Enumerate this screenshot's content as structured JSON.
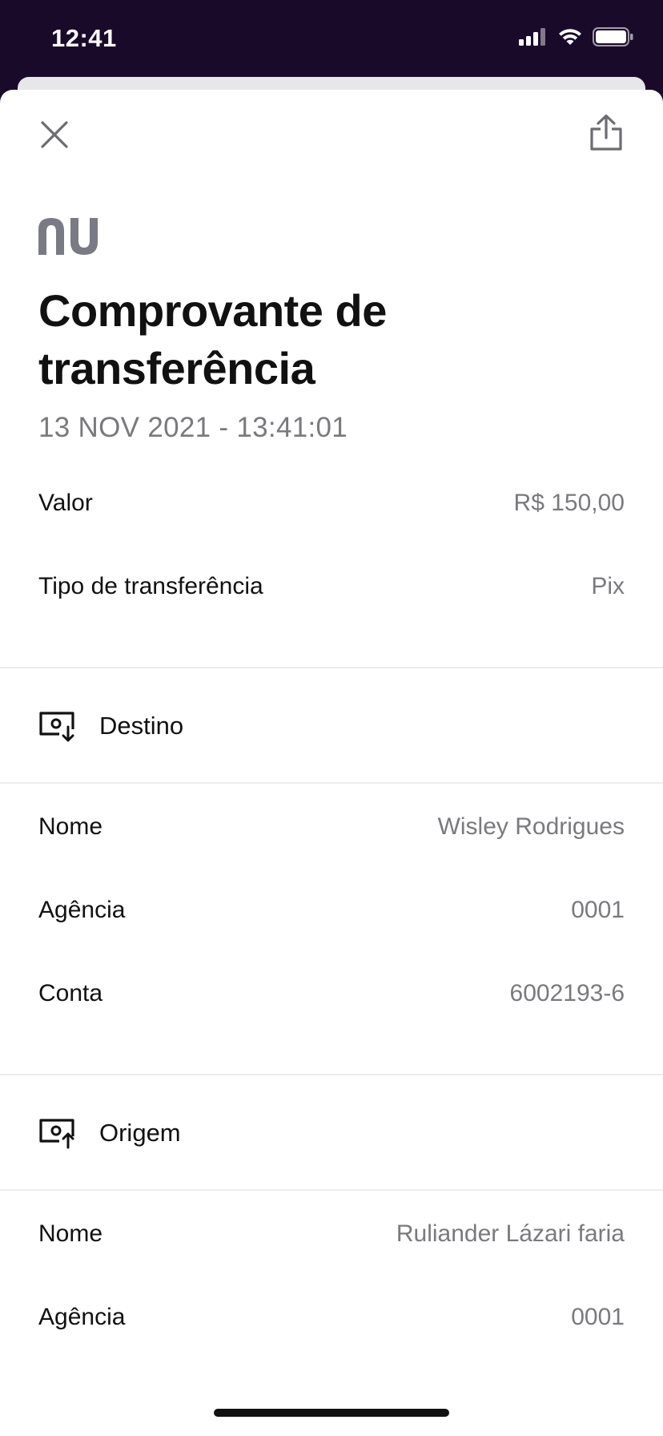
{
  "status_bar": {
    "time": "12:41"
  },
  "header": {
    "close_icon": "close-icon",
    "share_icon": "share-icon"
  },
  "brand": {
    "logo": "nu",
    "color": "#7a7a85"
  },
  "receipt": {
    "title": "Comprovante de transferência",
    "datetime": "13 NOV 2021 - 13:41:01"
  },
  "summary": [
    {
      "label": "Valor",
      "value": "R$ 150,00"
    },
    {
      "label": "Tipo de transferência",
      "value": "Pix"
    }
  ],
  "destino": {
    "title": "Destino",
    "icon": "money-in-icon",
    "rows": [
      {
        "label": "Nome",
        "value": "Wisley Rodrigues"
      },
      {
        "label": "Agência",
        "value": "0001"
      },
      {
        "label": "Conta",
        "value": "6002193-6"
      }
    ]
  },
  "origem": {
    "title": "Origem",
    "icon": "money-out-icon",
    "rows": [
      {
        "label": "Nome",
        "value": "Ruliander Lázari faria"
      },
      {
        "label": "Agência",
        "value": "0001"
      }
    ]
  },
  "colors": {
    "status_bar_bg": "#1a0a2a",
    "text_primary": "#111111",
    "text_secondary": "#7a7a7e"
  }
}
